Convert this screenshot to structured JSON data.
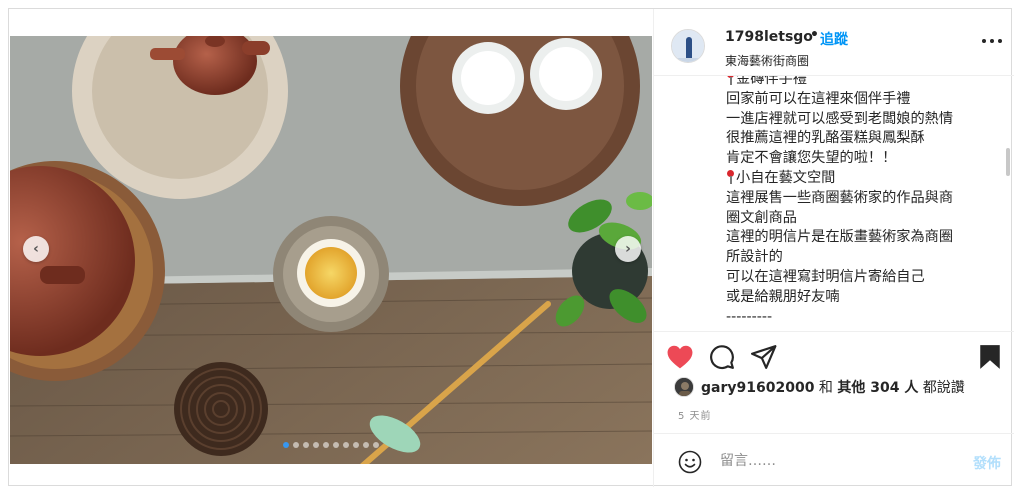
{
  "post": {
    "username": "1798letsgo",
    "separator": "•",
    "follow_label": "追蹤",
    "location": "東海藝術街商圈",
    "caption_lines": [
      {
        "pin": true,
        "text": "金磚伴手禮"
      },
      {
        "pin": false,
        "text": "回家前可以在這裡來個伴手禮"
      },
      {
        "pin": false,
        "text": "一進店裡就可以感受到老闆娘的熱情"
      },
      {
        "pin": false,
        "text": "很推薦這裡的乳酪蛋糕與鳳梨酥"
      },
      {
        "pin": false,
        "text": "肯定不會讓您失望的啦！！"
      },
      {
        "pin": true,
        "text": "小自在藝文空間"
      },
      {
        "pin": false,
        "text": "這裡展售一些商圈藝術家的作品與商"
      },
      {
        "pin": false,
        "text": "圈文創商品"
      },
      {
        "pin": false,
        "text": "這裡的明信片是在版畫藝術家為商圈"
      },
      {
        "pin": false,
        "text": "所設計的"
      },
      {
        "pin": false,
        "text": "可以在這裡寫封明信片寄給自己"
      },
      {
        "pin": false,
        "text": "或是給親朋好友喃"
      },
      {
        "pin": false,
        "text": "---------"
      }
    ],
    "likes": {
      "liker": "gary91602000",
      "and": "和",
      "others_label": "其他 304 人",
      "suffix": "都說讚"
    },
    "time_ago": "5 天前",
    "comment": {
      "placeholder": "留言……",
      "post_label": "發佈"
    }
  },
  "carousel": {
    "prev_icon": "‹",
    "next_icon": "›",
    "slide_count": 10,
    "active_index": 0
  },
  "colors": {
    "like_heart": "#ed4956",
    "follow": "#0095f6",
    "post_disabled": "#b2dffc",
    "active_dot": "#3897f0"
  },
  "icons": [
    "heart-icon",
    "comment-icon",
    "share-icon",
    "bookmark-icon",
    "emoji-icon",
    "more-icon",
    "chevron-left-icon",
    "chevron-right-icon"
  ]
}
